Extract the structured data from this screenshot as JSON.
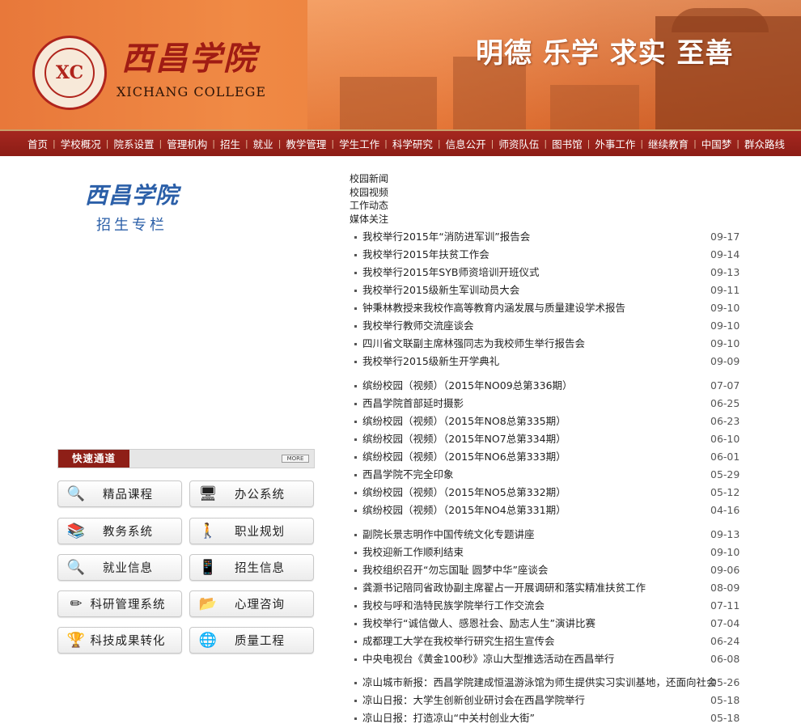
{
  "header": {
    "logo_seal_text": "XICHANG COLLEGE",
    "logo_cn": "西昌学院",
    "logo_en": "XICHANG COLLEGE",
    "motto": "明德 乐学 求实 至善"
  },
  "nav": {
    "items": [
      "首页",
      "学校概况",
      "院系设置",
      "管理机构",
      "招生",
      "就业",
      "教学管理",
      "学生工作",
      "科学研究",
      "信息公开",
      "师资队伍",
      "图书馆",
      "外事工作",
      "继续教育",
      "中国梦",
      "群众路线"
    ]
  },
  "left": {
    "title_cn": "西昌学院",
    "subtitle": "招生专栏",
    "quick_tab": "快速通道",
    "more_label": "MORE",
    "buttons": [
      {
        "label": "精品课程",
        "icon": "magnifier-icon"
      },
      {
        "label": "办公系统",
        "icon": "computer-icon"
      },
      {
        "label": "教务系统",
        "icon": "books-icon"
      },
      {
        "label": "职业规划",
        "icon": "walking-person-icon"
      },
      {
        "label": "就业信息",
        "icon": "magnifier-icon"
      },
      {
        "label": "招生信息",
        "icon": "phone-icon"
      },
      {
        "label": "科研管理系统",
        "icon": "pencil-icon"
      },
      {
        "label": "心理咨询",
        "icon": "folder-icon"
      },
      {
        "label": "科技成果转化",
        "icon": "trophy-icon"
      },
      {
        "label": "质量工程",
        "icon": "globe-icon"
      }
    ]
  },
  "categories": [
    "校园新闻",
    "校园视频",
    "工作动态",
    "媒体关注"
  ],
  "news_groups": [
    [
      {
        "title": "我校举行2015年“消防进军训”报告会",
        "date": "09-17"
      },
      {
        "title": "我校举行2015年扶贫工作会",
        "date": "09-14"
      },
      {
        "title": "我校举行2015年SYB师资培训开班仪式",
        "date": "09-13"
      },
      {
        "title": "我校举行2015级新生军训动员大会",
        "date": "09-11"
      },
      {
        "title": "钟秉林教授来我校作高等教育内涵发展与质量建设学术报告",
        "date": "09-10"
      },
      {
        "title": "我校举行教师交流座谈会",
        "date": "09-10"
      },
      {
        "title": "四川省文联副主席林强同志为我校师生举行报告会",
        "date": "09-10"
      },
      {
        "title": "我校举行2015级新生开学典礼",
        "date": "09-09"
      }
    ],
    [
      {
        "title": "缤纷校园（视频）（2015年NO09总第336期）",
        "date": "07-07"
      },
      {
        "title": "西昌学院首部延时摄影",
        "date": "06-25"
      },
      {
        "title": "缤纷校园（视频）（2015年NO8总第335期）",
        "date": "06-23"
      },
      {
        "title": "缤纷校园（视频）（2015年NO7总第334期）",
        "date": "06-10"
      },
      {
        "title": "缤纷校园（视频）（2015年NO6总第333期）",
        "date": "06-01"
      },
      {
        "title": "西昌学院不完全印象",
        "date": "05-29"
      },
      {
        "title": "缤纷校园（视频）（2015年NO5总第332期）",
        "date": "05-12"
      },
      {
        "title": "缤纷校园（视频）（2015年NO4总第331期）",
        "date": "04-16"
      }
    ],
    [
      {
        "title": "副院长景志明作中国传统文化专题讲座",
        "date": "09-13"
      },
      {
        "title": "我校迎新工作顺利结束",
        "date": "09-10"
      },
      {
        "title": "我校组织召开“勿忘国耻 圆梦中华”座谈会",
        "date": "09-06"
      },
      {
        "title": "龚灏书记陪同省政协副主席翟占一开展调研和落实精准扶贫工作",
        "date": "08-09"
      },
      {
        "title": "我校与呼和浩特民族学院举行工作交流会",
        "date": "07-11"
      },
      {
        "title": "我校举行“诚信做人、感恩社会、励志人生”演讲比赛",
        "date": "07-04"
      },
      {
        "title": "成都理工大学在我校举行研究生招生宣传会",
        "date": "06-24"
      },
      {
        "title": "中央电视台《黄金100秒》凉山大型推选活动在西昌举行",
        "date": "06-08"
      }
    ],
    [
      {
        "title": "凉山城市新报：西昌学院建成恒温游泳馆为师生提供实习实训基地，还面向社会",
        "date": "05-26"
      },
      {
        "title": "凉山日报：大学生创新创业研讨会在西昌学院举行",
        "date": "05-18"
      },
      {
        "title": "凉山日报：打造凉山“中关村创业大街”",
        "date": "05-18"
      }
    ]
  ]
}
